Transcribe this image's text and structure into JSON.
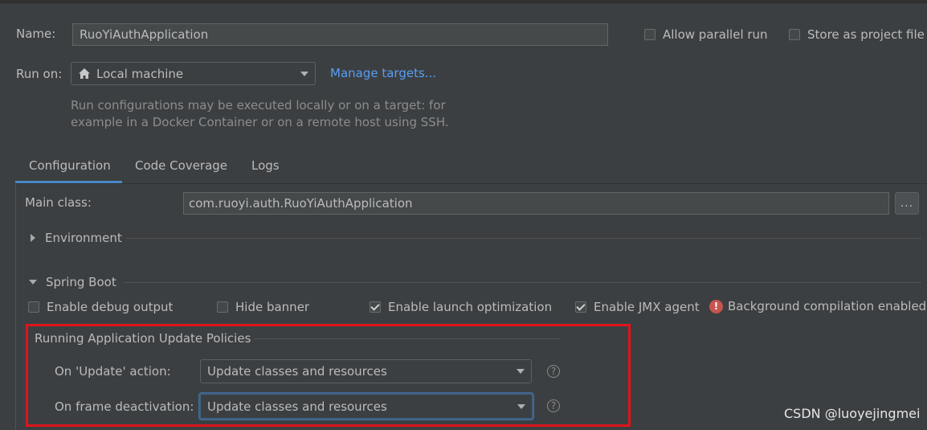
{
  "header": {
    "name_label": "Name:",
    "name_value": "RuoYiAuthApplication",
    "allow_parallel_run": {
      "label": "Allow parallel run",
      "checked": false
    },
    "store_as_project_file": {
      "label": "Store as project file",
      "checked": false
    }
  },
  "run_on": {
    "label": "Run on:",
    "selected": "Local machine",
    "icon": "home-icon",
    "manage_link": "Manage targets...",
    "hint_line1": "Run configurations may be executed locally or on a target: for",
    "hint_line2": "example in a Docker Container or on a remote host using SSH."
  },
  "tabs": [
    {
      "label": "Configuration",
      "active": true
    },
    {
      "label": "Code Coverage",
      "active": false
    },
    {
      "label": "Logs",
      "active": false
    }
  ],
  "configuration": {
    "main_class_label": "Main class:",
    "main_class_value": "com.ruoyi.auth.RuoYiAuthApplication",
    "browse_button": "...",
    "environment_section": "Environment",
    "spring_boot_section": "Spring Boot",
    "options": [
      {
        "label": "Enable debug output",
        "checked": false
      },
      {
        "label": "Hide banner",
        "checked": false
      },
      {
        "label": "Enable launch optimization",
        "checked": true
      },
      {
        "label": "Enable JMX agent",
        "checked": true
      }
    ],
    "warning_text": "Background compilation enabled",
    "update_policies": {
      "title": "Running Application Update Policies",
      "on_update_label": "On 'Update' action:",
      "on_update_value": "Update classes and resources",
      "on_frame_label": "On frame deactivation:",
      "on_frame_value": "Update classes and resources",
      "help_glyph": "?"
    }
  },
  "watermark": "CSDN @luoyejingmei",
  "colors": {
    "background": "#3c3f41",
    "link": "#589df6",
    "tab_accent": "#4a88c7",
    "highlight_box": "#e0131b",
    "error": "#c75450"
  }
}
